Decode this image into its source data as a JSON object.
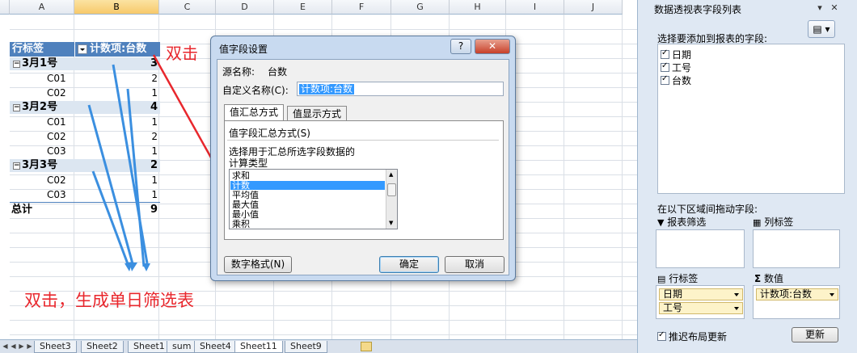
{
  "sheet": {
    "columns": [
      "A",
      "B",
      "C",
      "D",
      "E",
      "F",
      "G",
      "H",
      "I",
      "J"
    ],
    "selected_column": "B",
    "pivot": {
      "header_row_label": "行标签",
      "header_value": "计数项:台数",
      "rows": [
        {
          "label": "3月1号",
          "value": "3",
          "level": 0
        },
        {
          "label": "C01",
          "value": "2",
          "level": 1
        },
        {
          "label": "C02",
          "value": "1",
          "level": 1
        },
        {
          "label": "3月2号",
          "value": "4",
          "level": 0
        },
        {
          "label": "C01",
          "value": "1",
          "level": 1
        },
        {
          "label": "C02",
          "value": "2",
          "level": 1
        },
        {
          "label": "C03",
          "value": "1",
          "level": 1
        },
        {
          "label": "3月3号",
          "value": "2",
          "level": 0
        },
        {
          "label": "C02",
          "value": "1",
          "level": 1
        },
        {
          "label": "C03",
          "value": "1",
          "level": 1
        }
      ],
      "total_label": "总计",
      "total_value": "9"
    }
  },
  "annotations": {
    "top": "双击",
    "bottom": "双击，生成单日筛选表",
    "color": "#e8272d",
    "arrow_color": "#3b8fe0"
  },
  "sheet_tabs": [
    "Sheet3",
    "Sheet2",
    "Sheet1",
    "sum",
    "Sheet4",
    "Sheet11",
    "Sheet9"
  ],
  "active_tab": "Sheet11",
  "dialog": {
    "title": "值字段设置",
    "help": "?",
    "close": "✕",
    "source_label": "源名称:",
    "source_value": "台数",
    "custom_name_label": "自定义名称(C):",
    "custom_name_value": "计数项:台数",
    "tabs": [
      "值汇总方式",
      "值显示方式"
    ],
    "active_tab": "值汇总方式",
    "section_label": "值字段汇总方式(S)",
    "desc_line1": "选择用于汇总所选字段数据的",
    "desc_line2": "计算类型",
    "list_items": [
      "求和",
      "计数",
      "平均值",
      "最大值",
      "最小值",
      "乘积"
    ],
    "selected_item": "计数",
    "number_format_button": "数字格式(N)",
    "ok_button": "确定",
    "cancel_button": "取消"
  },
  "field_list": {
    "title": "数据透视表字段列表",
    "choose_label": "选择要添加到报表的字段:",
    "fields": [
      "日期",
      "工号",
      "台数"
    ],
    "drag_label": "在以下区域间拖动字段:",
    "areas": {
      "filter": "报表筛选",
      "columns": "列标签",
      "rows": "行标签",
      "values": "数值"
    },
    "row_fields": [
      "日期",
      "工号"
    ],
    "value_fields": [
      "计数项:台数"
    ],
    "defer_label": "推迟布局更新",
    "update_button": "更新"
  }
}
